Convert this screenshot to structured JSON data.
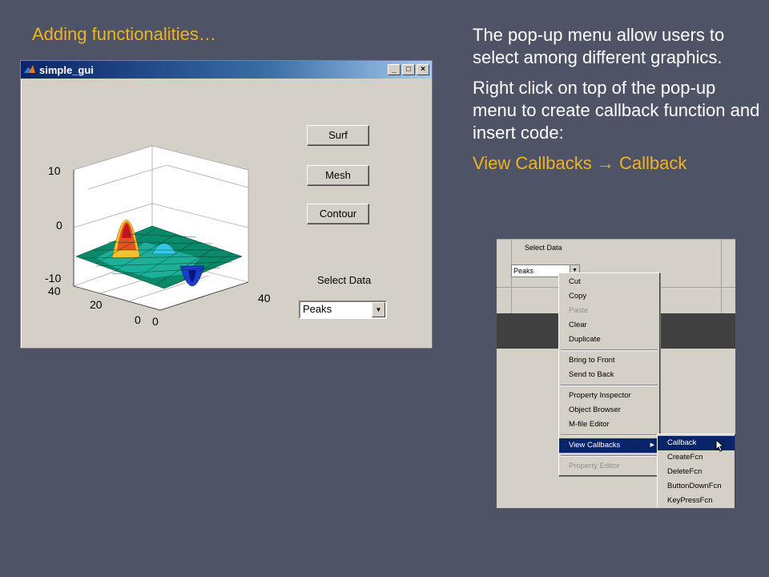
{
  "slide": {
    "title": "Adding functionalities…",
    "para1": "The pop-up menu allow users to select among different graphics.",
    "para2": "Right click on top of the pop-up menu to create callback function and insert code:",
    "para3": "View Callbacks → Callback"
  },
  "window": {
    "title": "simple_gui",
    "buttons": {
      "surf": "Surf",
      "mesh": "Mesh",
      "contour": "Contour"
    },
    "select_label": "Select Data",
    "popup_value": "Peaks",
    "controls": {
      "minimize": "_",
      "maximize": "□",
      "close": "×"
    }
  },
  "plot": {
    "z_ticks": [
      "10",
      "0",
      "-10"
    ],
    "y_ticks": [
      "40",
      "20",
      "0"
    ],
    "x_ticks": [
      "0",
      "40"
    ]
  },
  "context_shot": {
    "select_label": "Select Data",
    "popup_value": "Peaks",
    "menu1": [
      "Cut",
      "Copy",
      "Paste",
      "Clear",
      "Duplicate",
      "Bring to Front",
      "Send to Back",
      "Property Inspector",
      "Object Browser",
      "M-file Editor",
      "View Callbacks",
      "Property Editor"
    ],
    "menu2": [
      "Callback",
      "CreateFcn",
      "DeleteFcn",
      "ButtonDownFcn",
      "KeyPressFcn"
    ]
  },
  "colors": {
    "background": "#4f5366",
    "accent": "#f0b323",
    "titlebar": "#0a246a"
  }
}
